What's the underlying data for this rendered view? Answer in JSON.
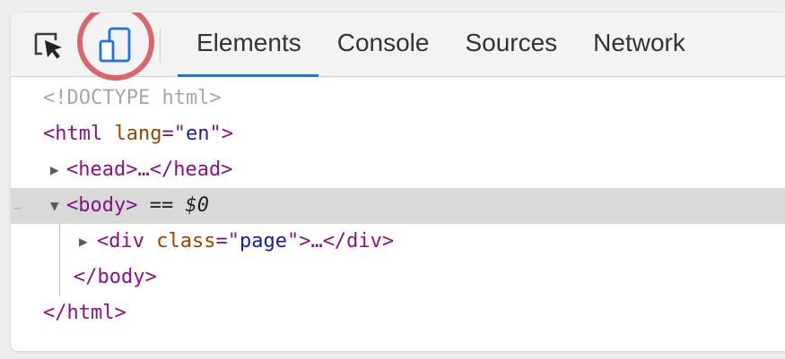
{
  "toolbar": {
    "inspect_icon": "inspect-element-icon",
    "device_icon": "device-toolbar-icon",
    "accent_color": "#1a73e8",
    "highlight_color": "#d9666c",
    "tabs": [
      {
        "label": "Elements",
        "active": true
      },
      {
        "label": "Console",
        "active": false
      },
      {
        "label": "Sources",
        "active": false
      },
      {
        "label": "Network",
        "active": false
      }
    ]
  },
  "dom_tree": {
    "selected_row": "body",
    "lines": {
      "doctype": "<!DOCTYPE html>",
      "html_open_tag": "<html",
      "html_attr_name": "lang",
      "html_attr_eq": "=\"",
      "html_attr_value": "en",
      "html_attr_close": "\">",
      "head_tag": "<head>…</head>",
      "body_open_tag": "<body>",
      "body_marker": "== ",
      "body_var": "$0",
      "gutter_dots": "…",
      "div_open_tag": "<div",
      "div_attr_name": "class",
      "div_attr_eq": "=\"",
      "div_attr_value": "page",
      "div_attr_close": "\">…</div>",
      "body_close_tag": "</body>",
      "html_close_tag": "</html>"
    },
    "arrows": {
      "collapsed": "▶",
      "expanded": "▼"
    }
  }
}
